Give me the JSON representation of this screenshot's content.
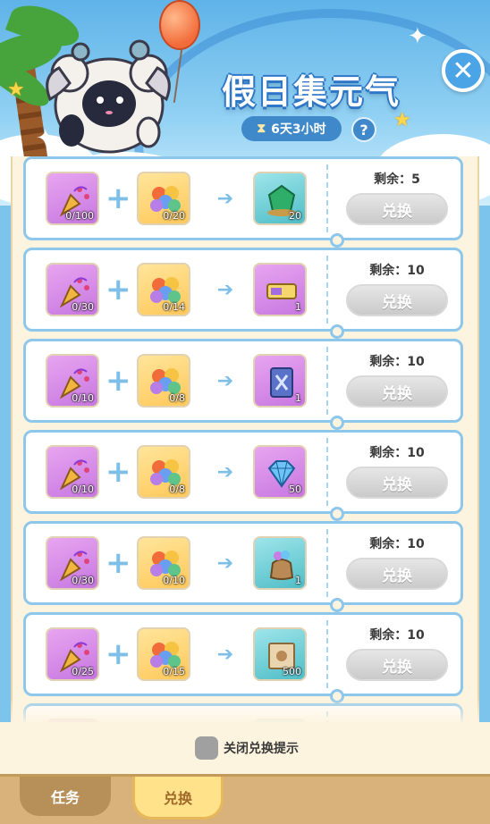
{
  "header": {
    "title": "假日集元气",
    "timer": "6天3小时",
    "help": "?",
    "close": "✕"
  },
  "rows": [
    {
      "cost1": "0/100",
      "cost2": "0/20",
      "reward_icon": "emerald-gem-icon",
      "reward_color": "teal",
      "reward_count": "20",
      "remain": "剩余：5",
      "button": "兑换"
    },
    {
      "cost1": "0/30",
      "cost2": "0/14",
      "reward_icon": "ticket-icon",
      "reward_color": "purple",
      "reward_count": "1",
      "remain": "剩余：10",
      "button": "兑换"
    },
    {
      "cost1": "0/10",
      "cost2": "0/8",
      "reward_icon": "card-icon",
      "reward_color": "purple",
      "reward_count": "1",
      "remain": "剩余：10",
      "button": "兑换"
    },
    {
      "cost1": "0/10",
      "cost2": "0/8",
      "reward_icon": "diamond-icon",
      "reward_color": "purple",
      "reward_count": "50",
      "remain": "剩余：10",
      "button": "兑换"
    },
    {
      "cost1": "0/30",
      "cost2": "0/10",
      "reward_icon": "candy-bag-icon",
      "reward_color": "teal",
      "reward_count": "1",
      "remain": "剩余：10",
      "button": "兑换"
    },
    {
      "cost1": "0/25",
      "cost2": "0/15",
      "reward_icon": "map-scroll-icon",
      "reward_color": "teal",
      "reward_count": "500",
      "remain": "剩余：10",
      "button": "兑换"
    }
  ],
  "footer": {
    "toggle_label": "关闭兑换提示"
  },
  "tabs": {
    "task": "任务",
    "exchange": "兑换"
  }
}
